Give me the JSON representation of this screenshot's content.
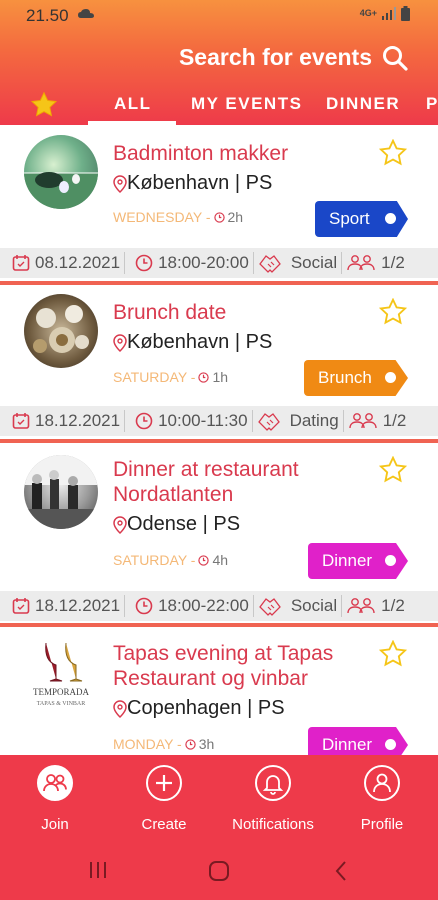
{
  "status": {
    "time": "21.50",
    "network": "4G+"
  },
  "header": {
    "search_title": "Search for events",
    "tabs": [
      "ALL",
      "MY EVENTS",
      "DINNER",
      "PA"
    ]
  },
  "events": [
    {
      "title": "Badminton makker",
      "location": "København | PS",
      "day": "WEDNESDAY -",
      "duration": "2h",
      "tag": "Sport",
      "date": "08.12.2021",
      "time": "18:00-20:00",
      "type": "Social",
      "spots": "1/2"
    },
    {
      "title": "Brunch date",
      "location": "København | PS",
      "day": "SATURDAY -",
      "duration": "1h",
      "tag": "Brunch",
      "date": "18.12.2021",
      "time": "10:00-11:30",
      "type": "Dating",
      "spots": "1/2"
    },
    {
      "title": "Dinner at restaurant Nordatlanten",
      "location": "Odense | PS",
      "day": "SATURDAY -",
      "duration": "4h",
      "tag": "Dinner",
      "date": "18.12.2021",
      "time": "18:00-22:00",
      "type": "Social",
      "spots": "1/2"
    },
    {
      "title": "Tapas evening at Tapas Restaurant og vinbar",
      "location": "Copenhagen | PS",
      "day": "MONDAY -",
      "duration": "3h",
      "tag": "Dinner",
      "logo_text": "TEMPORADA",
      "logo_subtext": "TAPAS & VINBAR"
    }
  ],
  "nav": {
    "join": "Join",
    "create": "Create",
    "notifications": "Notifications",
    "profile": "Profile"
  },
  "colors": {
    "accent": "#ee3a4a",
    "sport": "#1a47c8",
    "brunch": "#f08a14",
    "dinner": "#e021c9",
    "star": "#f5c518"
  }
}
